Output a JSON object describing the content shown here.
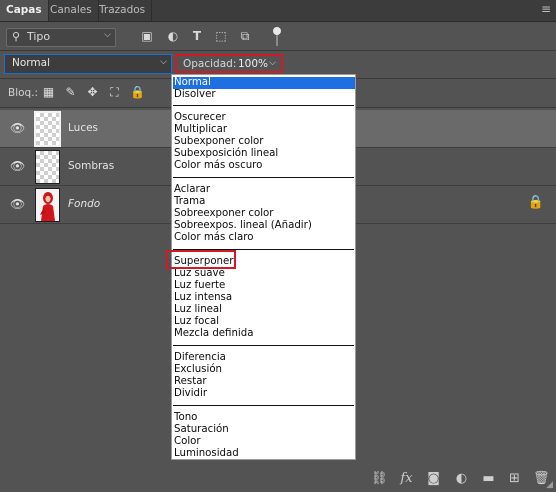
{
  "tabs": [
    "Capas",
    "Canales",
    "Trazados"
  ],
  "filter": {
    "value": "Tipo",
    "icons": [
      "image-filter-icon",
      "adjustment-filter-icon",
      "type-filter-icon",
      "shape-filter-icon",
      "smart-object-filter-icon",
      "filter-toggle"
    ]
  },
  "blend_mode": {
    "value": "Normal"
  },
  "opacity": {
    "label": "Opacidad:",
    "value": "100%"
  },
  "lock": {
    "label": "Bloq.:"
  },
  "layers": [
    {
      "name": "Luces",
      "selected": true
    },
    {
      "name": "Sombras",
      "selected": false
    },
    {
      "name": "Fondo",
      "selected": false,
      "locked": true
    }
  ],
  "dropdown": {
    "groups": [
      [
        "Normal",
        "Disolver"
      ],
      [
        "Oscurecer",
        "Multiplicar",
        "Subexponer color",
        "Subexposición lineal",
        "Color más oscuro"
      ],
      [
        "Aclarar",
        "Trama",
        "Sobreexponer color",
        "Sobreexpos. lineal (Añadir)",
        "Color más claro"
      ],
      [
        "Superponer",
        "Luz suave",
        "Luz fuerte",
        "Luz intensa",
        "Luz lineal",
        "Luz focal",
        "Mezcla definida"
      ],
      [
        "Diferencia",
        "Exclusión",
        "Restar",
        "Dividir"
      ],
      [
        "Tono",
        "Saturación",
        "Color",
        "Luminosidad"
      ]
    ],
    "highlighted": "Normal",
    "outlined": "Superponer"
  },
  "colors": {
    "panel_bg": "#535353",
    "highlight": "#1e6fe0",
    "annotation_red": "#d01b26"
  }
}
